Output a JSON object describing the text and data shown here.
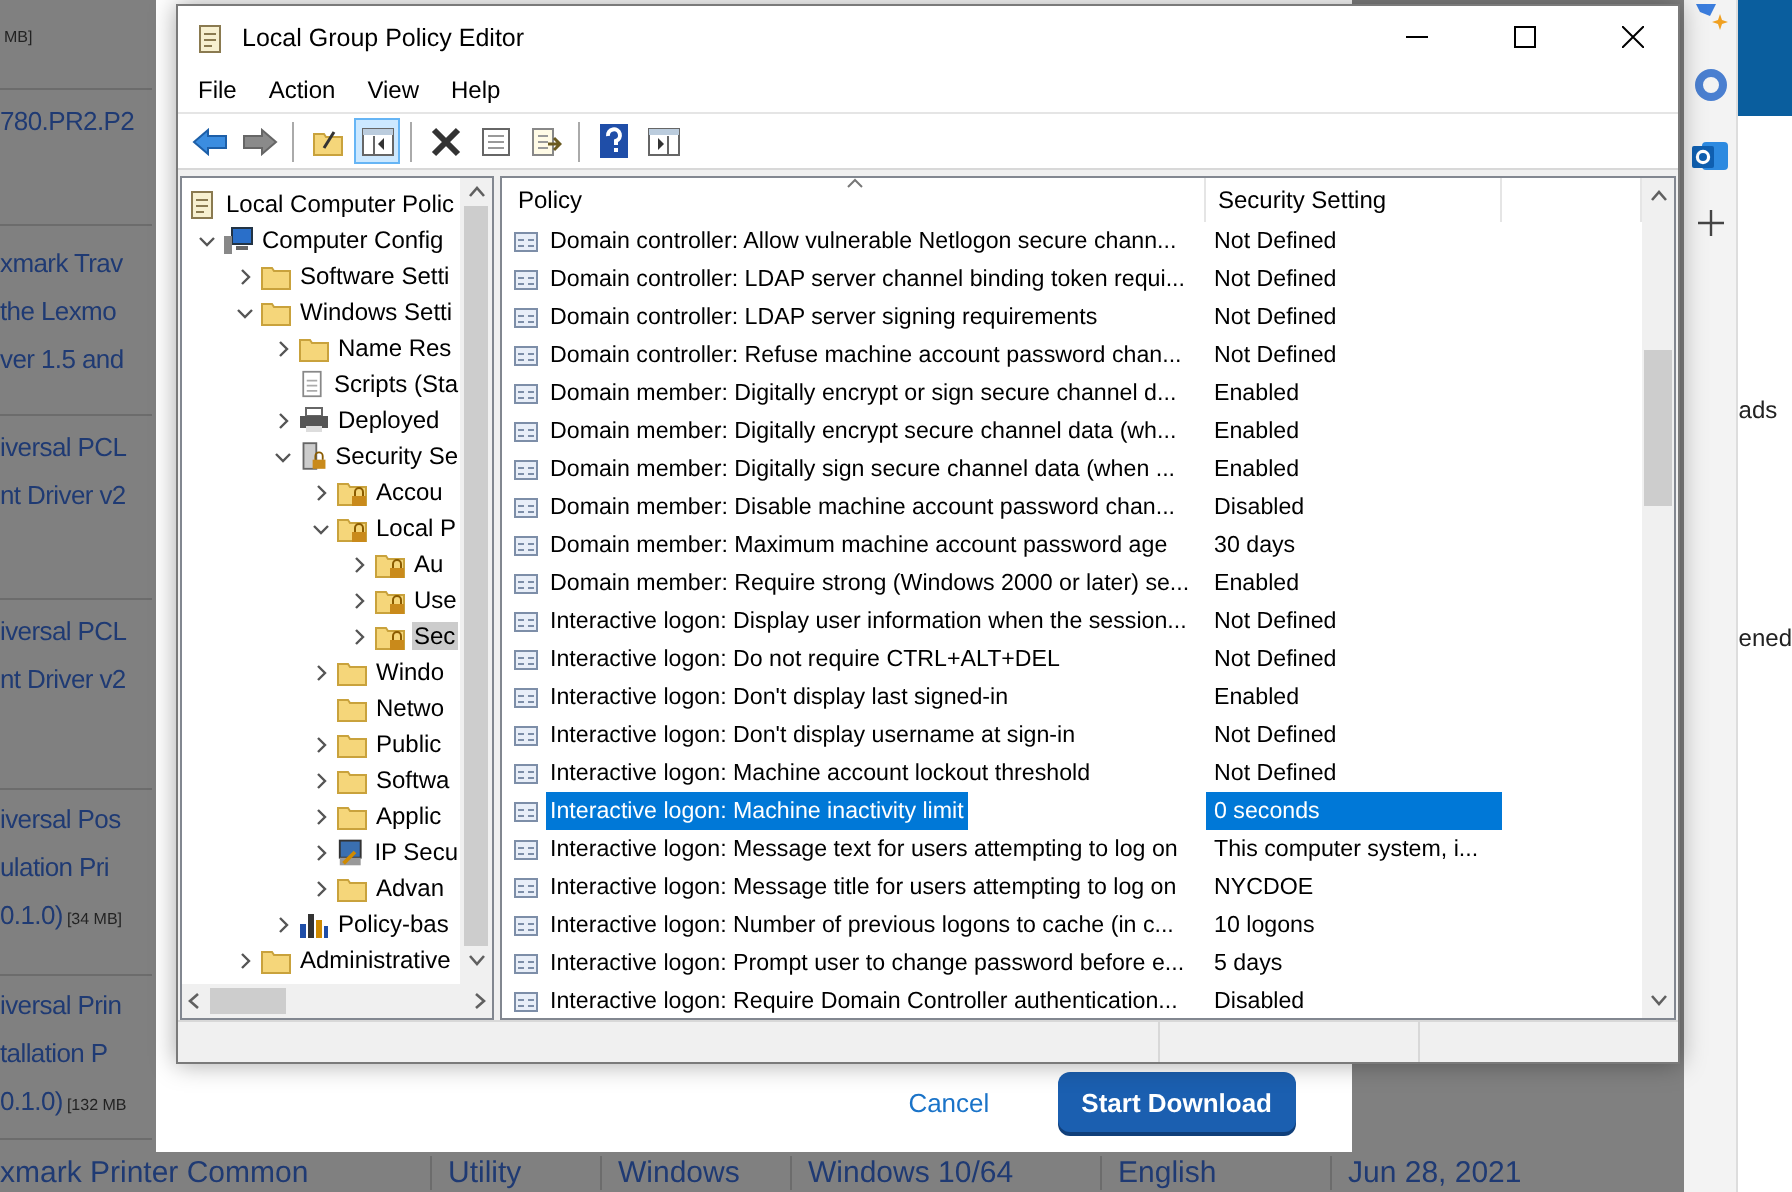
{
  "background_page": {
    "left_fragments": [
      {
        "size_note": "MB]"
      },
      {
        "lines": [
          "780.PR2.P2"
        ]
      },
      {
        "lines": [
          "xmark Trav",
          "the Lexmo",
          "ver 1.5 and"
        ]
      },
      {
        "lines": [
          "iversal PCL",
          "nt Driver v2"
        ]
      },
      {
        "lines": [
          "iversal PCL",
          "nt Driver v2"
        ]
      },
      {
        "lines": [
          "iversal Pos",
          "ulation Pri",
          "0.1.0)"
        ],
        "size_note": "[34 MB]"
      },
      {
        "lines": [
          "iversal Prin",
          "tallation P",
          "0.1.0)"
        ],
        "size_note": "[132 MB"
      }
    ],
    "bottom_row": [
      "xmark Printer Common",
      "Utility",
      "Windows",
      "Windows 10/64",
      "English",
      "Jun 28, 2021"
    ],
    "right_fragments": [
      "ads",
      "ened"
    ]
  },
  "dialog": {
    "cancel": "Cancel",
    "confirm": "Start Download"
  },
  "window": {
    "title": "Local Group Policy Editor",
    "menu": [
      "File",
      "Action",
      "View",
      "Help"
    ],
    "toolbar": [
      {
        "kind": "back",
        "pressed": false
      },
      {
        "kind": "forward",
        "pressed": false
      },
      {
        "kind": "separator"
      },
      {
        "kind": "up",
        "pressed": false
      },
      {
        "kind": "tree",
        "pressed": true
      },
      {
        "kind": "separator"
      },
      {
        "kind": "delete",
        "pressed": false
      },
      {
        "kind": "properties",
        "pressed": false
      },
      {
        "kind": "export",
        "pressed": false
      },
      {
        "kind": "separator"
      },
      {
        "kind": "help",
        "pressed": false
      },
      {
        "kind": "pane",
        "pressed": false
      }
    ],
    "tree": [
      {
        "label": "Local Computer Polic",
        "kind": "policy",
        "selected": false,
        "children": [
          {
            "label": "Computer Config",
            "kind": "computer",
            "expanded": true,
            "selected": false,
            "children": [
              {
                "label": "Software Setti",
                "kind": "folder",
                "expanded": false,
                "selected": false
              },
              {
                "label": "Windows Setti",
                "kind": "folder",
                "expanded": true,
                "selected": false,
                "children": [
                  {
                    "label": "Name Res",
                    "kind": "folder",
                    "expanded": false,
                    "selected": false
                  },
                  {
                    "label": "Scripts (Sta",
                    "kind": "script",
                    "selected": false
                  },
                  {
                    "label": "Deployed",
                    "kind": "printer",
                    "expanded": false,
                    "selected": false
                  },
                  {
                    "label": "Security Se",
                    "kind": "security",
                    "expanded": true,
                    "selected": false,
                    "children": [
                      {
                        "label": "Accou",
                        "kind": "locked",
                        "expanded": false,
                        "selected": false
                      },
                      {
                        "label": "Local P",
                        "kind": "locked",
                        "expanded": true,
                        "selected": false,
                        "children": [
                          {
                            "label": "Au",
                            "kind": "locked",
                            "expanded": false,
                            "selected": false
                          },
                          {
                            "label": "Use",
                            "kind": "locked",
                            "expanded": false,
                            "selected": false
                          },
                          {
                            "label": "Sec",
                            "kind": "locked",
                            "expanded": false,
                            "selected": true
                          }
                        ]
                      },
                      {
                        "label": "Windo",
                        "kind": "folder",
                        "expanded": false,
                        "selected": false
                      },
                      {
                        "label": "Netwo",
                        "kind": "folder",
                        "selected": false
                      },
                      {
                        "label": "Public",
                        "kind": "folder",
                        "expanded": false,
                        "selected": false
                      },
                      {
                        "label": "Softwa",
                        "kind": "folder",
                        "expanded": false,
                        "selected": false
                      },
                      {
                        "label": "Applic",
                        "kind": "folder",
                        "expanded": false,
                        "selected": false
                      },
                      {
                        "label": "IP Secu",
                        "kind": "ipsec",
                        "expanded": false,
                        "selected": false
                      },
                      {
                        "label": "Advan",
                        "kind": "folder",
                        "expanded": false,
                        "selected": false
                      }
                    ]
                  },
                  {
                    "label": "Policy-bas",
                    "kind": "chart",
                    "expanded": false,
                    "selected": false
                  }
                ]
              },
              {
                "label": "Administrative",
                "kind": "folder",
                "expanded": false,
                "selected": false
              }
            ]
          }
        ]
      }
    ],
    "table": {
      "columns": [
        "Policy",
        "Security Setting"
      ],
      "rows": [
        {
          "policy": "Domain controller: Allow vulnerable Netlogon secure chann...",
          "setting": "Not Defined",
          "selected": false
        },
        {
          "policy": "Domain controller: LDAP server channel binding token requi...",
          "setting": "Not Defined",
          "selected": false
        },
        {
          "policy": "Domain controller: LDAP server signing requirements",
          "setting": "Not Defined",
          "selected": false
        },
        {
          "policy": "Domain controller: Refuse machine account password chan...",
          "setting": "Not Defined",
          "selected": false
        },
        {
          "policy": "Domain member: Digitally encrypt or sign secure channel d...",
          "setting": "Enabled",
          "selected": false
        },
        {
          "policy": "Domain member: Digitally encrypt secure channel data (wh...",
          "setting": "Enabled",
          "selected": false
        },
        {
          "policy": "Domain member: Digitally sign secure channel data (when ...",
          "setting": "Enabled",
          "selected": false
        },
        {
          "policy": "Domain member: Disable machine account password chan...",
          "setting": "Disabled",
          "selected": false
        },
        {
          "policy": "Domain member: Maximum machine account password age",
          "setting": "30 days",
          "selected": false
        },
        {
          "policy": "Domain member: Require strong (Windows 2000 or later) se...",
          "setting": "Enabled",
          "selected": false
        },
        {
          "policy": "Interactive logon: Display user information when the session...",
          "setting": "Not Defined",
          "selected": false
        },
        {
          "policy": "Interactive logon: Do not require CTRL+ALT+DEL",
          "setting": "Not Defined",
          "selected": false
        },
        {
          "policy": "Interactive logon: Don't display last signed-in",
          "setting": "Enabled",
          "selected": false
        },
        {
          "policy": "Interactive logon: Don't display username at sign-in",
          "setting": "Not Defined",
          "selected": false
        },
        {
          "policy": "Interactive logon: Machine account lockout threshold",
          "setting": "Not Defined",
          "selected": false
        },
        {
          "policy": "Interactive logon: Machine inactivity limit",
          "setting": "0 seconds",
          "selected": true
        },
        {
          "policy": "Interactive logon: Message text for users attempting to log on",
          "setting": "This computer system, i...",
          "selected": false
        },
        {
          "policy": "Interactive logon: Message title for users attempting to log on",
          "setting": "NYCDOE",
          "selected": false
        },
        {
          "policy": "Interactive logon: Number of previous logons to cache (in c...",
          "setting": "10 logons",
          "selected": false
        },
        {
          "policy": "Interactive logon: Prompt user to change password before e...",
          "setting": "5 days",
          "selected": false
        },
        {
          "policy": "Interactive logon: Require Domain Controller authentication...",
          "setting": "Disabled",
          "selected": false
        }
      ]
    }
  }
}
